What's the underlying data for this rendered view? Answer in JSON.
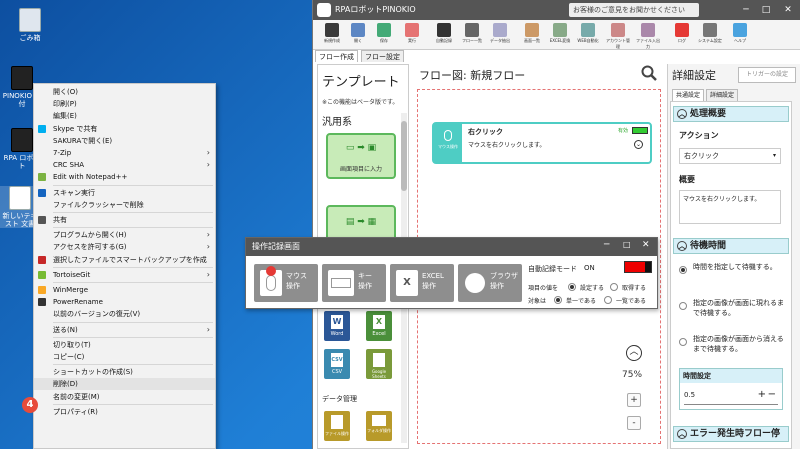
{
  "desktop": {
    "icons": [
      {
        "label": "ごみ箱"
      },
      {
        "label": "PINOKIO 送付"
      },
      {
        "label": "RPA ロボット"
      },
      {
        "label": "新しいテキスト 文書"
      }
    ]
  },
  "context_menu": {
    "items": [
      {
        "label": "開く(O)",
        "icon": "",
        "arrow": false
      },
      {
        "label": "印刷(P)",
        "icon": "",
        "arrow": false
      },
      {
        "label": "編集(E)",
        "icon": "",
        "arrow": false
      },
      {
        "label": "Skype で共有",
        "icon": "skype-icon",
        "arrow": false
      },
      {
        "label": "SAKURAで開く(E)",
        "icon": "",
        "arrow": false
      },
      {
        "label": "7-Zip",
        "icon": "",
        "arrow": true
      },
      {
        "label": "CRC SHA",
        "icon": "",
        "arrow": true
      },
      {
        "label": "Edit with Notepad++",
        "icon": "notepad-icon",
        "arrow": false
      },
      {
        "label": "スキャン実行",
        "icon": "scan-icon",
        "arrow": false
      },
      {
        "label": "ファイルクラッシャーで削除",
        "icon": "",
        "arrow": false
      },
      {
        "label": "共有",
        "icon": "share-icon",
        "arrow": false
      },
      {
        "label": "プログラムから開く(H)",
        "icon": "",
        "arrow": true
      },
      {
        "label": "アクセスを許可する(G)",
        "icon": "",
        "arrow": true
      },
      {
        "label": "選択したファイルでスマートバックアップを作成",
        "icon": "backup-icon",
        "arrow": false
      },
      {
        "label": "TortoiseGit",
        "icon": "git-icon",
        "arrow": true
      },
      {
        "label": "WinMerge",
        "icon": "winmerge-icon",
        "arrow": false
      },
      {
        "label": "PowerRename",
        "icon": "rename-icon",
        "arrow": false
      },
      {
        "label": "以前のバージョンの復元(V)",
        "icon": "",
        "arrow": false
      },
      {
        "label": "送る(N)",
        "icon": "",
        "arrow": true
      },
      {
        "label": "切り取り(T)",
        "icon": "",
        "arrow": false
      },
      {
        "label": "コピー(C)",
        "icon": "",
        "arrow": false
      },
      {
        "label": "ショートカットの作成(S)",
        "icon": "",
        "arrow": false
      },
      {
        "label": "削除(D)",
        "icon": "",
        "arrow": false
      },
      {
        "label": "名前の変更(M)",
        "icon": "",
        "arrow": false
      },
      {
        "label": "プロパティ(R)",
        "icon": "",
        "arrow": false
      }
    ],
    "step_badge": "4"
  },
  "app": {
    "title": "RPAロボットPINOKIO",
    "feedback": "お客様のご意見をお聞かせください",
    "toolbar": [
      "新規作成",
      "開く",
      "保存",
      "実行",
      "自動記録",
      "フロー一覧",
      "データ抽出",
      "画面一覧",
      "EXCEL変換",
      "WEB自動化",
      "アカウント管理",
      "ファイル入出力",
      "ログ",
      "システム設定",
      "ヘルプ"
    ],
    "tabs": [
      "フロー作成",
      "フロー設定"
    ],
    "template": {
      "title": "テンプレート",
      "note": "※この機能はベータ版です。",
      "section": "汎用系",
      "card1_label": "画面項目に入力",
      "data_section": "データ管理",
      "squares": [
        "Word",
        "Excel",
        "CSV",
        "Google Sheets",
        "ファイル操作",
        "フォルダ操作"
      ]
    },
    "flow": {
      "title": "フロー図: 新規フロー",
      "node_title": "右クリック",
      "node_badge": "有効",
      "node_type": "マウス操作",
      "node_desc": "マウスを右クリックします。",
      "zoom": "75%",
      "zoom_in": "+",
      "zoom_out": "-"
    },
    "details": {
      "title": "詳細設定",
      "trigger_btn": "トリガーの設定",
      "tabs": [
        "共通設定",
        "詳細設定"
      ],
      "section1": "処理概要",
      "action_label": "アクション",
      "action_value": "右クリック",
      "summary_label": "概要",
      "summary_value": "マウスを右クリックします。",
      "section2": "待機時間",
      "wait_options": [
        "時間を指定して待機する。",
        "指定の画像が画面に現れるまで待機する。",
        "指定の画像が画面から消えるまで待機する。"
      ],
      "time_label": "時間設定",
      "time_value": "0.5",
      "section3": "エラー発生時フロー停"
    }
  },
  "recorder": {
    "title": "操作記録画面",
    "buttons": [
      {
        "line1": "マウス",
        "line2": "操作"
      },
      {
        "line1": "キー",
        "line2": "操作"
      },
      {
        "line1": "EXCEL",
        "line2": "操作"
      },
      {
        "line1": "ブラウザ",
        "line2": "操作"
      }
    ],
    "auto_mode_label": "自動記録モード",
    "auto_mode_value": "ON",
    "value_label": "項目の値を",
    "value_opt1": "設定する",
    "value_opt2": "取得する",
    "target_label": "対象は",
    "target_opt1": "単一である",
    "target_opt2": "一覧である"
  }
}
